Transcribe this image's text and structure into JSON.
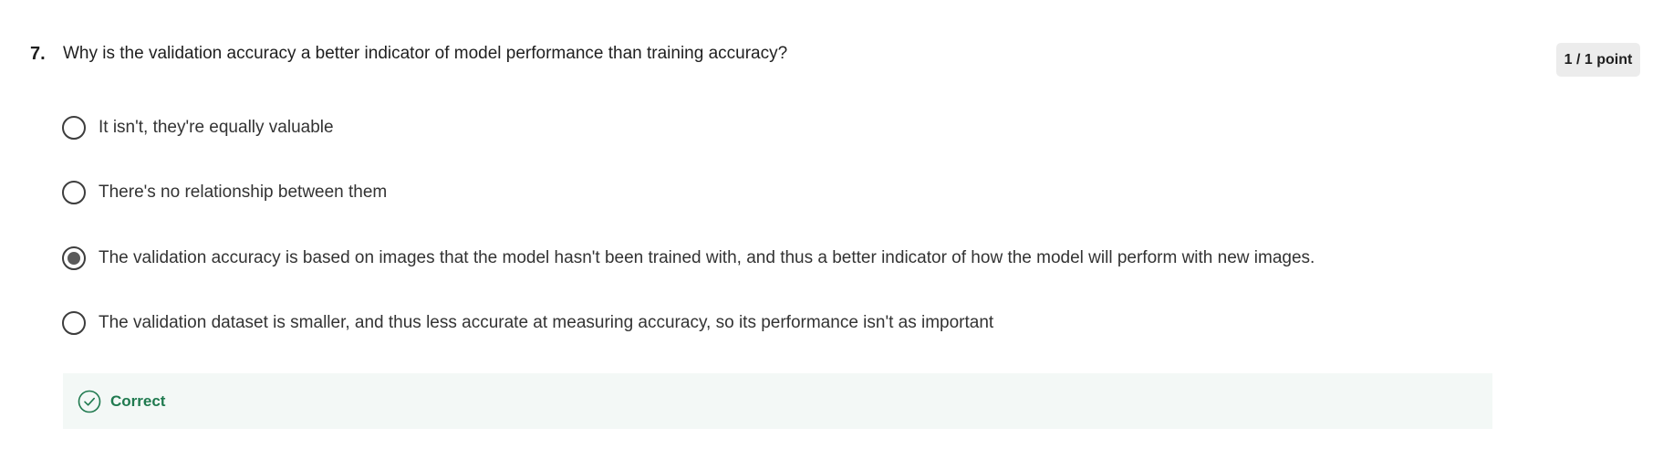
{
  "question": {
    "number": "7.",
    "text": "Why is the validation accuracy a better indicator of model performance than training accuracy?",
    "score": "1 / 1 point"
  },
  "options": [
    {
      "label": "It isn't, they're equally valuable",
      "selected": false
    },
    {
      "label": "There's no relationship between them",
      "selected": false
    },
    {
      "label": "The validation accuracy is based on images that the model hasn't been trained with, and thus a better indicator of how the model will perform with new images.",
      "selected": true
    },
    {
      "label": "The validation dataset is smaller, and thus less accurate at measuring accuracy, so its performance isn't as important",
      "selected": false
    }
  ],
  "feedback": {
    "label": "Correct",
    "icon": "check-circle-icon",
    "color": "#1f7a4f",
    "background": "#f3f8f6"
  }
}
